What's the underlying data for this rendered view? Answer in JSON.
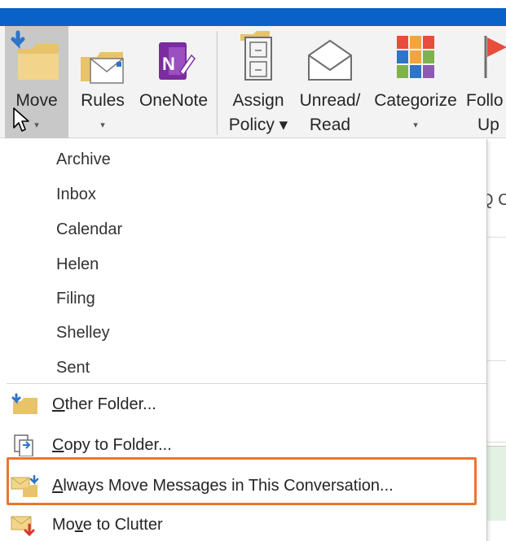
{
  "ribbon": {
    "buttons": [
      {
        "line1": "Move",
        "line2": "▾"
      },
      {
        "line1": "Rules",
        "line2": "▾"
      },
      {
        "line1": "OneNote",
        "line2": ""
      },
      {
        "line1": "Assign",
        "line2": "Policy ▾"
      },
      {
        "line1": "Unread/",
        "line2": "Read"
      },
      {
        "line1": "Categorize",
        "line2": "▾"
      },
      {
        "line1": "Follo",
        "line2": "Up"
      }
    ],
    "partial_text": "Q C"
  },
  "menu": {
    "folders": [
      "Archive",
      "Inbox",
      "Calendar",
      "Helen",
      "Filing",
      "Shelley",
      "Sent"
    ],
    "commands": [
      {
        "mnemonic": "O",
        "rest": "ther Folder..."
      },
      {
        "mnemonic": "C",
        "rest": "opy to Folder..."
      },
      {
        "mnemonic": "A",
        "rest": "lways Move Messages in This Conversation..."
      },
      {
        "pre": "Mo",
        "mnemonic": "v",
        "rest": "e to Clutter"
      }
    ]
  },
  "colors": {
    "titlebar": "#0a62c9",
    "highlight": "#e8772e",
    "move_hover": "#c8c8c8"
  }
}
